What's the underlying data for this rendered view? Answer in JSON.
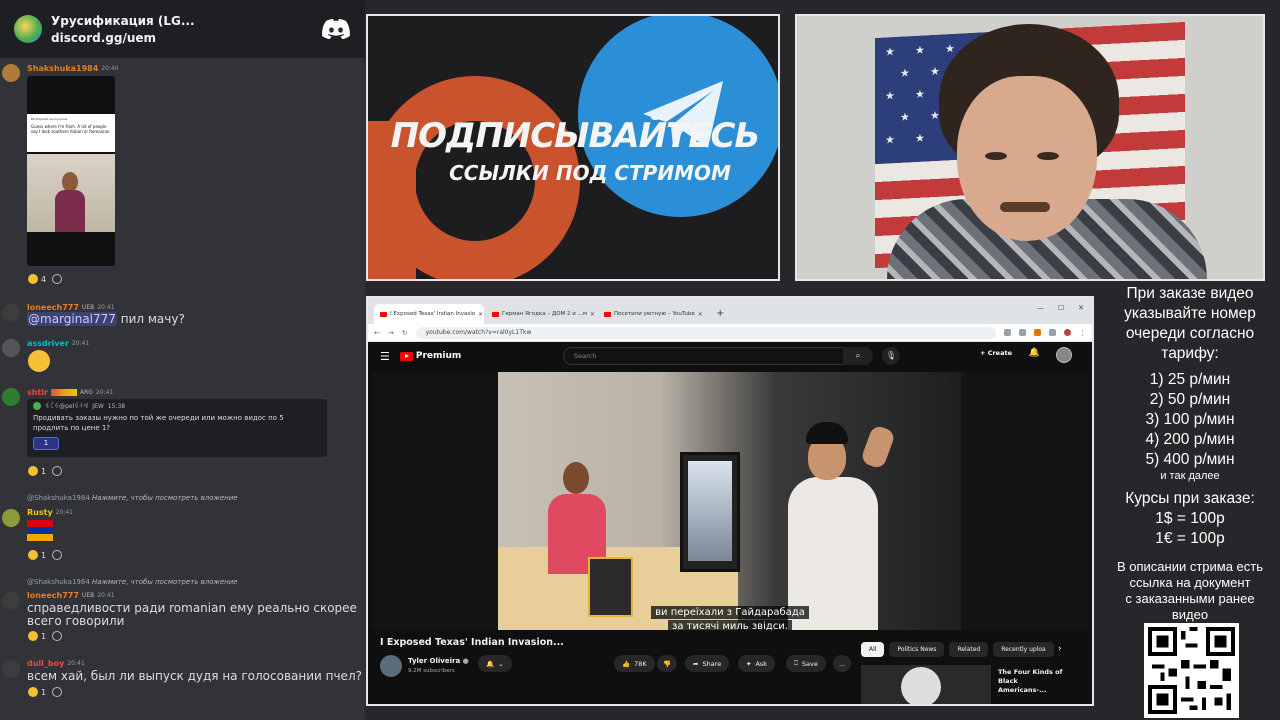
{
  "discord": {
    "server_name": "Урусификация (LG...",
    "server_link": "discord.gg/uem",
    "messages": [
      {
        "user": "Shakshuka1984",
        "time": "20:40",
        "user_color": "#e67e22",
        "screenshot": {
          "post_title": "Participants anonymous",
          "post_text": "Guess where I'm from. A lot of people say I look southern Italian or Romanian."
        },
        "reaction_count": "4"
      },
      {
        "user": "loneech777",
        "badge": "UEB",
        "time": "20:41",
        "user_color": "#e67e22",
        "mention": "@marginal777",
        "text": "пил мачу?"
      },
      {
        "user": "assdriver",
        "time": "20:41",
        "user_color": "#00bcd4"
      },
      {
        "user": "shtir",
        "badge": "ARG",
        "time": "20:41",
        "user_color": "#e74c3c",
        "embed": {
          "author": "ꑀꉓꑀ@pelꑀꊰꆂ",
          "badge": "JEW",
          "time": "15:38",
          "text": "Продивать заказы нужно по той же очереди или можно видос по 5 продлить по цене 1?",
          "button": "1"
        },
        "reaction_count": "1"
      },
      {
        "reply_user": "@Shakshuka1984",
        "reply_text": "Нажмите, чтобы посмотреть вложение",
        "user": "Rusty",
        "time": "20:41",
        "user_color": "#f1c40f",
        "reaction_count": "1"
      },
      {
        "reply_user": "@Shakshuka1984",
        "reply_text": "Нажмите, чтобы посмотреть вложение",
        "user": "loneech777",
        "badge": "UEB",
        "time": "20:41",
        "user_color": "#e67e22",
        "text": "справедливости ради romanian ему реально скорее всего говорили",
        "reaction_count": "1"
      },
      {
        "user": "dull_boy",
        "time": "20:41",
        "user_color": "#e74c3c",
        "text": "всем хай, был ли выпуск дудя на голосовании пчел?",
        "reaction_count": "1"
      }
    ]
  },
  "banner": {
    "title": "ПОДПИСЫВАЙТЕСЬ",
    "subtitle": "ССЫЛКИ ПОД СТРИМОМ",
    "colors": {
      "patreon": "#c9532d",
      "telegram": "#2a8fd6"
    }
  },
  "browser": {
    "tabs": [
      {
        "label": "I Exposed Texas' Indian Invasio"
      },
      {
        "label": "Герман Ягодка – ДОМ 2 и ...м"
      },
      {
        "label": "Посетили уютную – YouTube"
      }
    ],
    "url": "youtube.com/watch?v=ral0yL1Tkw",
    "youtube": {
      "logo": "Premium",
      "search_placeholder": "Search",
      "create_label": "Create",
      "subtitle_line1": "ви переїхали з Гайдарабада",
      "subtitle_line2": "за тисячі миль звідси.",
      "video_title": "I Exposed Texas' Indian Invasion...",
      "channel_name": "Tyler Oliveira",
      "channel_subs": "9.2M subscribers",
      "likes": "78K",
      "share": "Share",
      "ask": "Ask",
      "save": "Save",
      "more": "...",
      "chips": [
        "All",
        "Politics News",
        "Related",
        "Recently uploa"
      ],
      "related_title": "The Four Kinds of Black Americans-..."
    }
  },
  "pricing": {
    "intro": [
      "При заказе видео",
      "указывайте номер",
      "очереди согласно",
      "тарифу:"
    ],
    "tiers": [
      "1) 25 р/мин",
      "2) 50 р/мин",
      "3) 100 р/мин",
      "4) 200 р/мин",
      "5) 400 р/мин"
    ],
    "tiers_more": "и так далее",
    "rates_title": "Курсы при заказе:",
    "rates": [
      "1$ = 100р",
      "1€ = 100р"
    ],
    "note": [
      "В описании стрима есть",
      "ссылка на документ",
      "с заказанными ранее",
      "видео"
    ]
  }
}
